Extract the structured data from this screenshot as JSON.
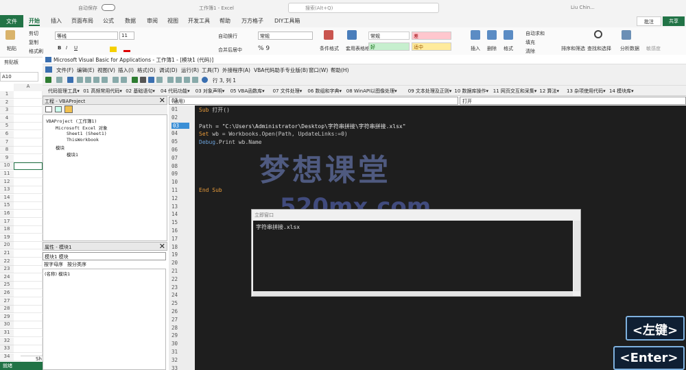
{
  "excel": {
    "autosave": "自动保存",
    "title": "工作簿1 - Excel",
    "search": "搜索(Alt+Q)",
    "user": "Liu Chin...",
    "tabs": [
      "文件",
      "开始",
      "插入",
      "页面布局",
      "公式",
      "数据",
      "审阅",
      "视图",
      "开发工具",
      "帮助",
      "万方格子",
      "DIY工具箱"
    ],
    "comment": "批注",
    "share": "共享",
    "ribbon": {
      "cut": "剪切",
      "copy": "复制",
      "paste": "粘贴",
      "format_painter": "格式刷",
      "clipboard": "剪贴板",
      "font": "等线",
      "font_size": "11",
      "wrap": "自动换行",
      "merge": "合并后居中",
      "number_format": "常规",
      "cond_format": "条件格式",
      "table_format": "套用表格格式",
      "style_normal": "常规",
      "style_bad": "差",
      "style_good": "好",
      "style_neutral": "适中",
      "insert": "插入",
      "delete": "删除",
      "format": "格式",
      "autosum": "自动求和",
      "fill": "填充",
      "clear": "清除",
      "sort": "排序和筛选",
      "find": "查找和选择",
      "analyze": "分析数据",
      "sensitivity": "敏感度"
    },
    "namebox": "A10",
    "column": "A",
    "rows": [
      "1",
      "2",
      "3",
      "4",
      "5",
      "6",
      "7",
      "8",
      "9",
      "10",
      "11",
      "12",
      "13",
      "14",
      "15",
      "16",
      "17",
      "18",
      "19",
      "20",
      "21",
      "22",
      "23",
      "24",
      "25",
      "26",
      "27",
      "28",
      "29",
      "30",
      "31",
      "32",
      "33",
      "34"
    ],
    "sheet": "Sh",
    "status": "就绪"
  },
  "vba": {
    "title": "Microsoft Visual Basic for Applications - 工作簿1 - [模块1 (代码)]",
    "menu": [
      "文件(F)",
      "编辑(E)",
      "视图(V)",
      "插入(I)",
      "格式(O)",
      "调试(D)",
      "运行(R)",
      "工具(T)",
      "外接程序(A)",
      "VBA代码助手专业版(B)",
      "窗口(W)",
      "帮助(H)"
    ],
    "position": "行 3, 列 1",
    "toolbar2": [
      "代码管理",
      "工具▾",
      "01 高频常用代码▾",
      "02 基础语句▾",
      "04 代码功能▾",
      "03 对象声明▾",
      "05 VBA函数库▾",
      "07 文件处理▾",
      "06 数组和字典▾",
      "08 WinAPI以图像处理▾",
      "09 文本处理及正则▾",
      "10 数据库操作▾",
      "11 网页交互和采集▾",
      "12 算法▾",
      "13 杂项使用代码▾",
      "14 模块库▾"
    ],
    "project": {
      "header": "工程 - VBAProject",
      "root": "VBAProject (工作簿1)",
      "excel_objects": "Microsoft Excel 对象",
      "sheet1": "Sheet1 (Sheet1)",
      "thisworkbook": "ThisWorkbook",
      "modules": "模块",
      "module1": "模块1"
    },
    "properties": {
      "header": "属性 - 模块1",
      "combo": "模块1 模块",
      "tab_alpha": "按字母序",
      "tab_cat": "按分类序",
      "name_row": "(名称)  模块1"
    },
    "code": {
      "object": "(通用)",
      "proc": "打开",
      "line_numbers": [
        "03",
        "01",
        "02",
        "03",
        "04",
        "05",
        "06",
        "07",
        "08",
        "09",
        "10",
        "11",
        "12",
        "13",
        "14",
        "15",
        "16",
        "17",
        "18",
        "19",
        "20",
        "21",
        "22",
        "23",
        "24",
        "25",
        "26",
        "27",
        "28",
        "29",
        "30",
        "31",
        "32",
        "33"
      ],
      "line1_kw": "Sub",
      "line1_rest": " 打开()",
      "line3_var": "Path",
      "line3_rest": " = \"C:\\Users\\Administrator\\Desktop\\字符串拼接\\字符串拼接.xlsx\"",
      "line4_kw": "Set",
      "line4_rest": " wb = Workbooks.Open(Path, UpdateLinks:=0)",
      "line5_obj": "Debug",
      "line5_rest": ".Print wb.Name",
      "line10": "End Sub"
    },
    "immediate": {
      "title": "立即窗口",
      "output": "字符串拼接.xlsx"
    }
  },
  "watermark": {
    "title": "梦想课堂",
    "site": "520mx.com"
  },
  "keys": {
    "left_click": "<左键>",
    "enter": "<Enter>"
  },
  "colors": {
    "excel_green": "#217346",
    "code_bg": "#1e1e1e",
    "keyword": "#e69a3a"
  }
}
